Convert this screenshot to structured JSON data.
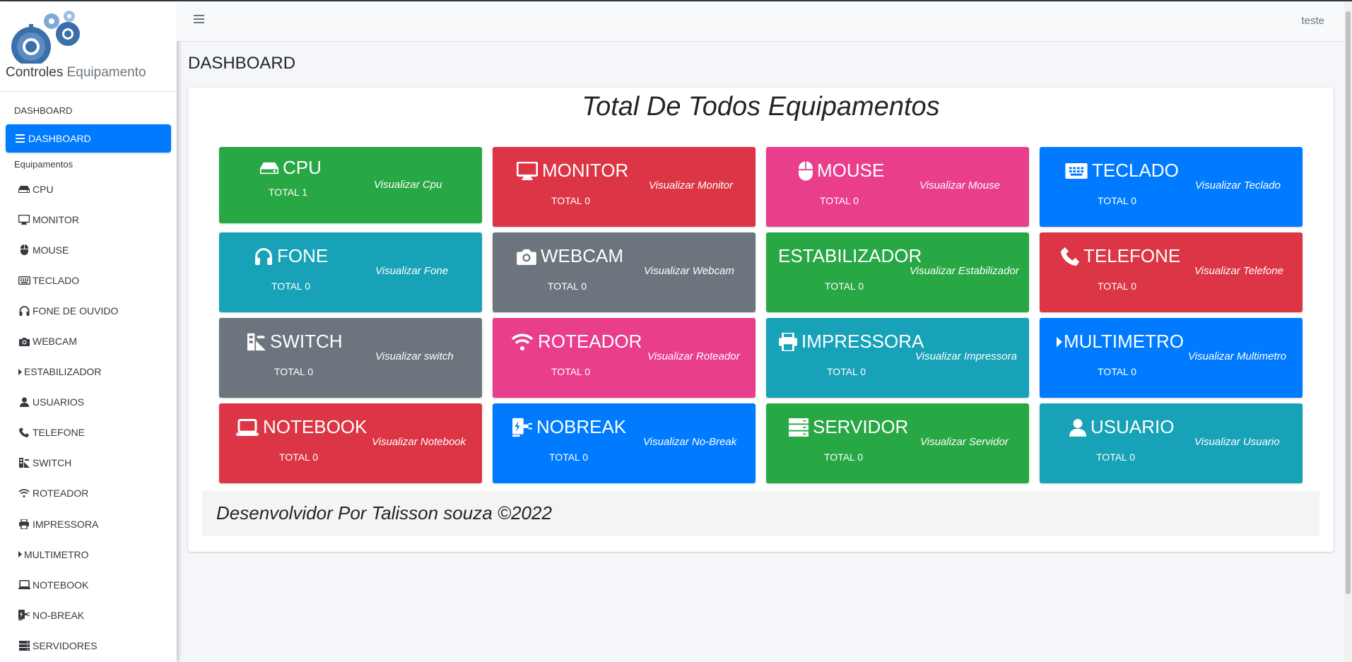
{
  "brand": {
    "name_dark": "Controles",
    "name_light": "Equipamento",
    "logo_icon": "gears-logo"
  },
  "topbar": {
    "menu_icon": "hamburger-icon",
    "user": "teste"
  },
  "page": {
    "title": "DASHBOARD"
  },
  "sidebar": {
    "header1": "DASHBOARD",
    "active": {
      "label": "DASHBOARD",
      "icon": "bars-icon"
    },
    "header2": "Equipamentos",
    "items": [
      {
        "label": "CPU",
        "icon": "hdd-icon"
      },
      {
        "label": "MONITOR",
        "icon": "monitor-icon"
      },
      {
        "label": "MOUSE",
        "icon": "mouse-icon"
      },
      {
        "label": "TECLADO",
        "icon": "keyboard-icon"
      },
      {
        "label": "FONE DE OUVIDO",
        "icon": "headphones-icon"
      },
      {
        "label": "WEBCAM",
        "icon": "camera-icon"
      },
      {
        "label": "ESTABILIZADOR",
        "icon": "caret-right-icon"
      },
      {
        "label": "USUARIOS",
        "icon": "user-icon"
      },
      {
        "label": "TELEFONE",
        "icon": "phone-icon"
      },
      {
        "label": "SWITCH",
        "icon": "switch-icon"
      },
      {
        "label": "ROTEADOR",
        "icon": "wifi-icon"
      },
      {
        "label": "IMPRESSORA",
        "icon": "printer-icon"
      },
      {
        "label": "MULTIMETRO",
        "icon": "caret-right-icon"
      },
      {
        "label": "NOTEBOOK",
        "icon": "laptop-icon"
      },
      {
        "label": "NO-BREAK",
        "icon": "plug-icon"
      },
      {
        "label": "SERVIDORES",
        "icon": "server-icon"
      }
    ]
  },
  "dashboard": {
    "title": "Total De Todos Equipamentos",
    "tiles": [
      {
        "name": "CPU",
        "total": "TOTAL 1",
        "link": "Visualizar Cpu",
        "color": "#28a745",
        "icon": "hdd-icon"
      },
      {
        "name": "MONITOR",
        "total": "TOTAL 0",
        "link": "Visualizar Monitor",
        "color": "#dc3545",
        "icon": "monitor-icon"
      },
      {
        "name": "MOUSE",
        "total": "TOTAL 0",
        "link": "Visualizar Mouse",
        "color": "#e83e8c",
        "icon": "mouse-icon"
      },
      {
        "name": "TECLADO",
        "total": "TOTAL 0",
        "link": "Visualizar Teclado",
        "color": "#007bff",
        "icon": "keyboard-icon"
      },
      {
        "name": "FONE",
        "total": "TOTAL 0",
        "link": "Visualizar Fone",
        "color": "#17a2b8",
        "icon": "headphones-icon"
      },
      {
        "name": "WEBCAM",
        "total": "TOTAL 0",
        "link": "Visualizar Webcam",
        "color": "#6c757d",
        "icon": "camera-icon"
      },
      {
        "name": "ESTABILIZADOR",
        "total": "TOTAL 0",
        "link": "Visualizar Estabilizador",
        "color": "#28a745",
        "icon": ""
      },
      {
        "name": "TELEFONE",
        "total": "TOTAL 0",
        "link": "Visualizar Telefone",
        "color": "#dc3545",
        "icon": "phone-icon"
      },
      {
        "name": "SWITCH",
        "total": "TOTAL 0",
        "link": "Visualizar switch",
        "color": "#6c757d",
        "icon": "switch-icon"
      },
      {
        "name": "ROTEADOR",
        "total": "TOTAL 0",
        "link": "Visualizar Roteador",
        "color": "#e83e8c",
        "icon": "wifi-icon"
      },
      {
        "name": "IMPRESSORA",
        "total": "TOTAL 0",
        "link": "Visualizar Impressora",
        "color": "#17a2b8",
        "icon": "printer-icon"
      },
      {
        "name": "MULTIMETRO",
        "total": "TOTAL 0",
        "link": "Visualizar Multimetro",
        "color": "#007bff",
        "icon": "caret-right-icon"
      },
      {
        "name": "NOTEBOOK",
        "total": "TOTAL 0",
        "link": "Visualizar Notebook",
        "color": "#dc3545",
        "icon": "laptop-icon"
      },
      {
        "name": "NOBREAK",
        "total": "TOTAL 0",
        "link": "Visualizar No-Break",
        "color": "#007bff",
        "icon": "plug-icon"
      },
      {
        "name": "SERVIDOR",
        "total": "TOTAL 0",
        "link": "Visualizar Servidor",
        "color": "#28a745",
        "icon": "server-icon"
      },
      {
        "name": "USUARIO",
        "total": "TOTAL 0",
        "link": "Visualizar Usuario",
        "color": "#17a2b8",
        "icon": "user-icon"
      }
    ]
  },
  "footer": {
    "text": "Desenvolvidor Por Talisson souza ©2022"
  }
}
